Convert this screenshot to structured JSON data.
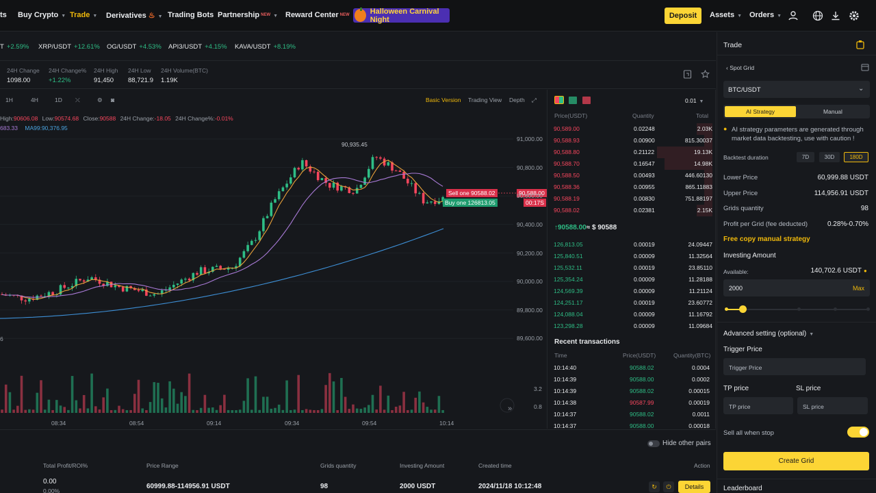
{
  "nav": {
    "items": [
      "ts",
      "Buy Crypto",
      "Trade",
      "Derivatives",
      "Trading Bots",
      "Partnership",
      "Reward Center"
    ],
    "active": "Trade",
    "hot_badge": "NEW",
    "promo": "Halloween Carnival Night",
    "deposit": "Deposit",
    "assets": "Assets",
    "orders": "Orders"
  },
  "ticker": [
    {
      "sym": "T",
      "chg": "+2.59%"
    },
    {
      "sym": "XRP/USDT",
      "chg": "+12.61%"
    },
    {
      "sym": "OG/USDT",
      "chg": "+4.53%"
    },
    {
      "sym": "API3/USDT",
      "chg": "+4.15%"
    },
    {
      "sym": "KAVA/USDT",
      "chg": "+8.19%"
    }
  ],
  "stats": [
    {
      "label": "24H Change",
      "value": "1098.00"
    },
    {
      "label": "24H Change%",
      "value": "+1.22%"
    },
    {
      "label": "24H High",
      "value": "91,450"
    },
    {
      "label": "24H Low",
      "value": "88,721.9"
    },
    {
      "label": "24H Volume(BTC)",
      "value": "1.19K"
    }
  ],
  "chart": {
    "timeframes": [
      "1H",
      "4H",
      "1D"
    ],
    "views": [
      "Basic Version",
      "Trading View",
      "Depth"
    ],
    "ohlc": {
      "high_label": "High:",
      "high": "90606.08",
      "low_label": "Low:",
      "low": "90574.68",
      "close_label": "Close:",
      "close": "90588",
      "chg_label": "24H Change:",
      "chg": "-18.05",
      "chgp_label": "24H Change%:",
      "chgp": "-0.01%"
    },
    "ma": {
      "left": "683.33",
      "ma99_label": "MA99:",
      "ma99": "90,376.95"
    },
    "peak_label": "90,935.45",
    "sell_tag": "Sell one 90588.02",
    "buy_tag": "Buy one 126813.05",
    "price_tag": "90,588.00",
    "countdown": "00:17S",
    "y_ticks": [
      "91,000.00",
      "90,800.00",
      "90,600.00",
      "90,400.00",
      "90,200.00",
      "90,000.00",
      "89,800.00",
      "89,600.00"
    ],
    "vol_ticks": [
      "3.2",
      "0.8"
    ],
    "x_ticks": [
      "08:34",
      "08:54",
      "09:14",
      "09:34",
      "09:54",
      "10:14"
    ],
    "left_edge": "6"
  },
  "orderbook": {
    "precision": "0.01",
    "headers": [
      "Price(USDT)",
      "Quantity",
      "Total"
    ],
    "asks": [
      [
        "90,589.00",
        "0.02248",
        "2.03K"
      ],
      [
        "90,588.93",
        "0.00900",
        "815.30037"
      ],
      [
        "90,588.80",
        "0.21122",
        "19.13K"
      ],
      [
        "90,588.70",
        "0.16547",
        "14.98K"
      ],
      [
        "90,588.50",
        "0.00493",
        "446.60130"
      ],
      [
        "90,588.36",
        "0.00955",
        "865.11883"
      ],
      [
        "90,588.19",
        "0.00830",
        "751.88197"
      ],
      [
        "90,588.02",
        "0.02381",
        "2.15K"
      ]
    ],
    "last_price": "↑90588.00",
    "last_usd": "≈ $ 90588",
    "bids": [
      [
        "126,813.05",
        "0.00019",
        "24.09447"
      ],
      [
        "125,840.51",
        "0.00009",
        "11.32564"
      ],
      [
        "125,532.11",
        "0.00019",
        "23.85110"
      ],
      [
        "125,354.24",
        "0.00009",
        "11.28188"
      ],
      [
        "124,569.39",
        "0.00009",
        "11.21124"
      ],
      [
        "124,251.17",
        "0.00019",
        "23.60772"
      ],
      [
        "124,088.04",
        "0.00009",
        "11.16792"
      ],
      [
        "123,298.28",
        "0.00009",
        "11.09684"
      ]
    ],
    "recent_title": "Recent transactions",
    "recent_headers": [
      "Time",
      "Price(USDT)",
      "Quantity(BTC)"
    ],
    "recent": [
      [
        "10:14:40",
        "90588.02",
        "0.0004",
        "buy"
      ],
      [
        "10:14:39",
        "90588.00",
        "0.0002",
        "buy"
      ],
      [
        "10:14:39",
        "90588.02",
        "0.00015",
        "buy"
      ],
      [
        "10:14:38",
        "90587.99",
        "0.00019",
        "sell"
      ],
      [
        "10:14:37",
        "90588.02",
        "0.0011",
        "buy"
      ],
      [
        "10:14:37",
        "90588.00",
        "0.00018",
        "buy"
      ]
    ]
  },
  "panel": {
    "title": "Trade",
    "back": "Spot Grid",
    "pair": "BTC/USDT",
    "tabs": [
      "AI Strategy",
      "Manual"
    ],
    "notice": "AI strategy parameters are generated through market data backtesting, use with caution !",
    "backtest_label": "Backtest duration",
    "backtest": [
      "7D",
      "30D",
      "180D"
    ],
    "rows": [
      {
        "label": "Lower Price",
        "value": "60,999.88 USDT"
      },
      {
        "label": "Upper Price",
        "value": "114,956.91 USDT"
      },
      {
        "label": "Grids quantity",
        "value": "98"
      },
      {
        "label": "Profit per Grid (fee deducted)",
        "value": "0.28%-0.70%"
      }
    ],
    "copy_link": "Free copy manual strategy",
    "invest_label": "Investing Amount",
    "available_label": "Available:",
    "available": "140,702.6 USDT",
    "amount": "2000",
    "max": "Max",
    "advanced": "Advanced setting (optional)",
    "trigger_label": "Trigger Price",
    "trigger_ph": "Trigger Price",
    "tp_label": "TP price",
    "tp_ph": "TP price",
    "sl_label": "SL price",
    "sl_ph": "SL price",
    "sell_all": "Sell all when stop",
    "create": "Create Grid",
    "leaderboard": "Leaderboard"
  },
  "bottom": {
    "hide_pairs": "Hide other pairs",
    "headers": [
      "Total Profit/ROI%",
      "Price Range",
      "Grids quantity",
      "Investing Amount",
      "Created time",
      "Action"
    ],
    "row": {
      "profit": "0.00",
      "roi": "0.00%",
      "range": "60999.88-114956.91 USDT",
      "grids": "98",
      "amount": "2000 USDT",
      "created": "2024/11/18 10:12:48",
      "details": "Details"
    }
  },
  "colors": {
    "accent": "#fcd535",
    "up": "#2ebd85",
    "down": "#f6465d"
  }
}
